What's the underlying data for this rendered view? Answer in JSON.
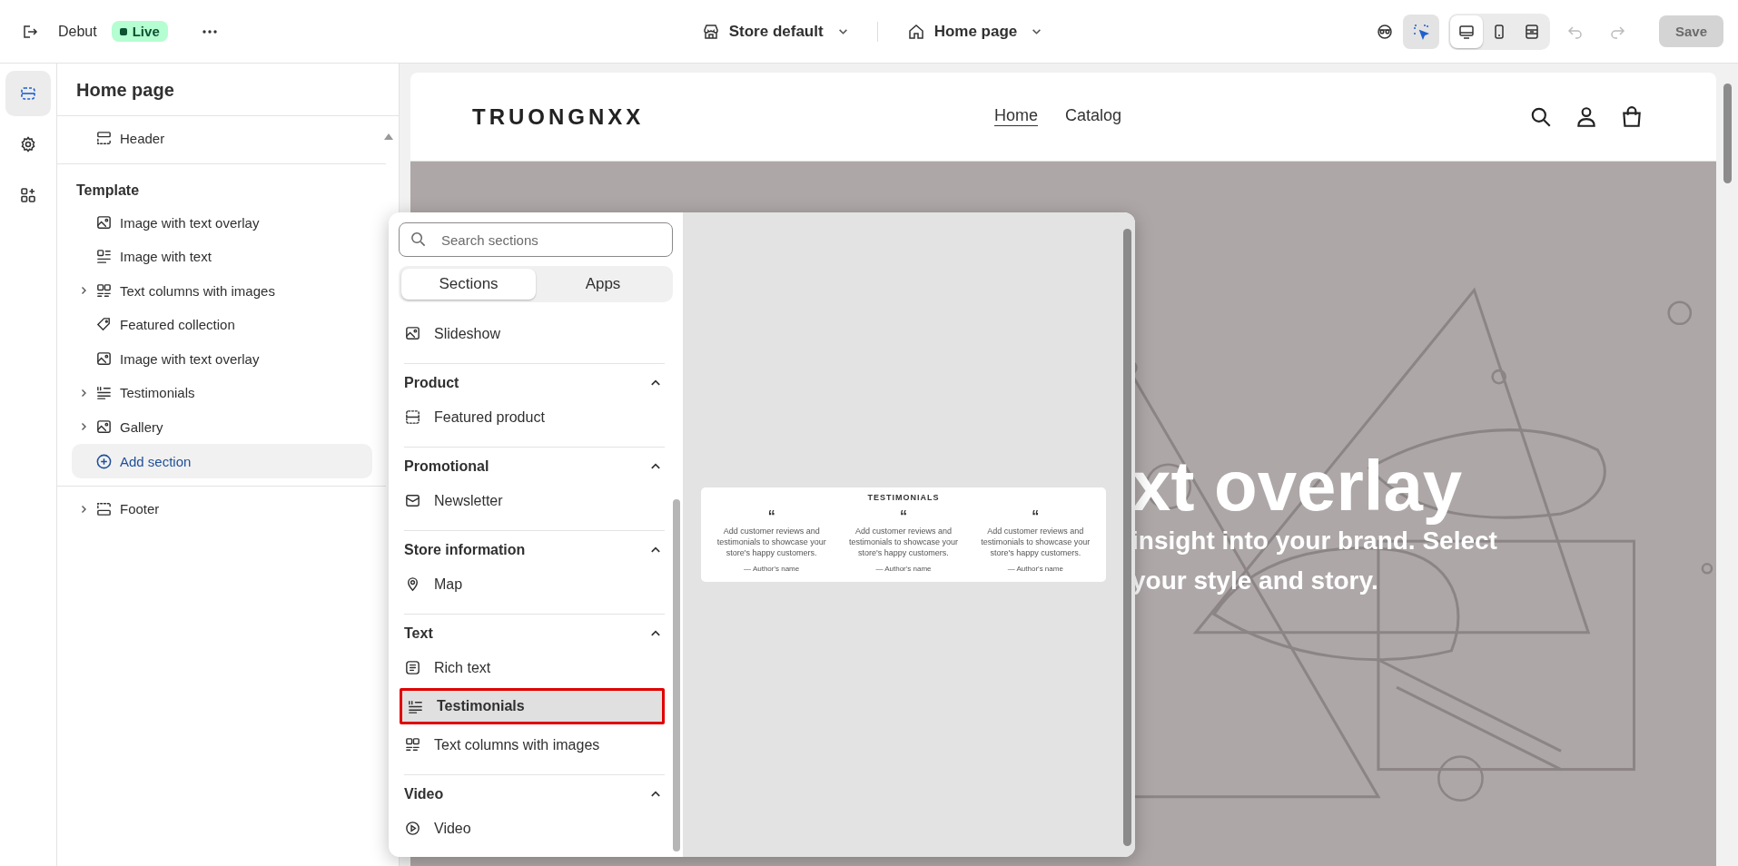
{
  "topbar": {
    "store_name": "Debut",
    "status": "Live",
    "store_selector": "Store default",
    "page_selector": "Home page",
    "inspector_on": true,
    "view_modes": [
      {
        "kind": "desktop",
        "selected": true
      },
      {
        "kind": "mobile",
        "selected": false
      },
      {
        "kind": "full",
        "selected": false
      }
    ],
    "save": {
      "label": "Save",
      "disabled": true
    }
  },
  "rail": [
    {
      "kind": "sections",
      "selected": true
    },
    {
      "kind": "settings",
      "selected": false
    },
    {
      "kind": "apps",
      "selected": false
    }
  ],
  "sidebar": {
    "title": "Home page",
    "header": {
      "label": "Header",
      "kind": "header",
      "expandable": false
    },
    "template": {
      "heading": "Template",
      "items": [
        {
          "label": "Image with text overlay",
          "kind": "image-overlay",
          "expandable": false
        },
        {
          "label": "Image with text",
          "kind": "image-text",
          "expandable": false
        },
        {
          "label": "Text columns with images",
          "kind": "columns",
          "expandable": true
        },
        {
          "label": "Featured collection",
          "kind": "collection",
          "expandable": false
        },
        {
          "label": "Image with text overlay",
          "kind": "image-overlay",
          "expandable": false
        },
        {
          "label": "Testimonials",
          "kind": "testimonials",
          "expandable": true
        },
        {
          "label": "Gallery",
          "kind": "gallery",
          "expandable": true
        }
      ],
      "add_section": "Add section"
    },
    "footer": {
      "label": "Footer",
      "kind": "footer",
      "expandable": true
    }
  },
  "store": {
    "logo": "TRUONGNXX",
    "nav": [
      {
        "label": "Home",
        "selected": true
      },
      {
        "label": "Catalog",
        "selected": false
      }
    ],
    "hero": {
      "title": "xt overlay",
      "lines": [
        "insight into your brand. Select",
        "your style and story."
      ]
    }
  },
  "picker": {
    "search_placeholder": "Search sections",
    "tabs": [
      {
        "label": "Sections",
        "selected": true
      },
      {
        "label": "Apps",
        "selected": false
      }
    ],
    "groups": [
      {
        "items": [
          {
            "label": "Slideshow",
            "kind": "slideshow",
            "selected": false
          }
        ]
      },
      {
        "heading": "Product",
        "expanded": true,
        "items": [
          {
            "label": "Featured product",
            "kind": "product",
            "selected": false
          }
        ]
      },
      {
        "heading": "Promotional",
        "expanded": true,
        "items": [
          {
            "label": "Newsletter",
            "kind": "newsletter",
            "selected": false
          }
        ]
      },
      {
        "heading": "Store information",
        "expanded": true,
        "items": [
          {
            "label": "Map",
            "kind": "map",
            "selected": false
          }
        ]
      },
      {
        "heading": "Text",
        "expanded": true,
        "items": [
          {
            "label": "Rich text",
            "kind": "rich-text",
            "selected": false
          },
          {
            "label": "Testimonials",
            "kind": "testimonials",
            "selected": true
          },
          {
            "label": "Text columns with images",
            "kind": "columns",
            "selected": false
          }
        ]
      },
      {
        "heading": "Video",
        "expanded": true,
        "items": [
          {
            "label": "Video",
            "kind": "video",
            "selected": false
          }
        ]
      }
    ],
    "preview": {
      "title": "TESTIMONIALS",
      "columns": [
        {
          "quote": "“",
          "text": "Add customer reviews and testimonials to showcase your store's happy customers.",
          "author": "— Author's name"
        },
        {
          "quote": "“",
          "text": "Add customer reviews and testimonials to showcase your store's happy customers.",
          "author": "— Author's name"
        },
        {
          "quote": "“",
          "text": "Add customer reviews and testimonials to showcase your store's happy customers.",
          "author": "— Author's name"
        }
      ]
    }
  }
}
